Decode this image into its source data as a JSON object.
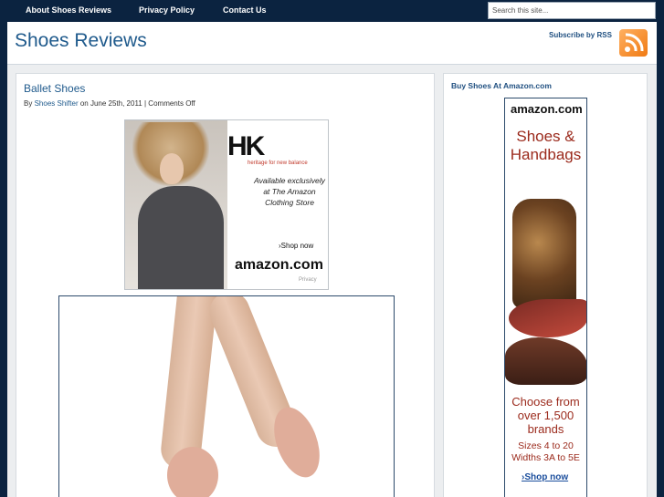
{
  "nav": {
    "items": [
      "About Shoes Reviews",
      "Privacy Policy",
      "Contact Us"
    ],
    "search_placeholder": "Search this site..."
  },
  "header": {
    "site_title": "Shoes Reviews",
    "rss_label": "Subscribe by RSS"
  },
  "post": {
    "title": "Ballet Shoes",
    "byline_prefix": "By",
    "author": "Shoes Shifter",
    "byline_date": "on June 25th, 2011 |",
    "comments": "Comments Off",
    "ad": {
      "brand": "HK",
      "brand_sub": "heritage for new balance",
      "text": "Available exclusively at The Amazon Clothing Store",
      "shop": "›Shop now",
      "amazon": "amazon.com",
      "privacy": "Privacy"
    }
  },
  "sidebar": {
    "title": "Buy Shoes At Amazon.com",
    "ad": {
      "amazon": "amazon.com",
      "headline": "Shoes & Handbags",
      "choose": "Choose from over 1,500 brands",
      "sizes": "Sizes 4 to 20 Widths 3A to 5E",
      "shop": "›Shop now"
    }
  },
  "colors": {
    "background": "#0b2340",
    "accent": "#1f5a8c",
    "rss": "#f07a13"
  }
}
